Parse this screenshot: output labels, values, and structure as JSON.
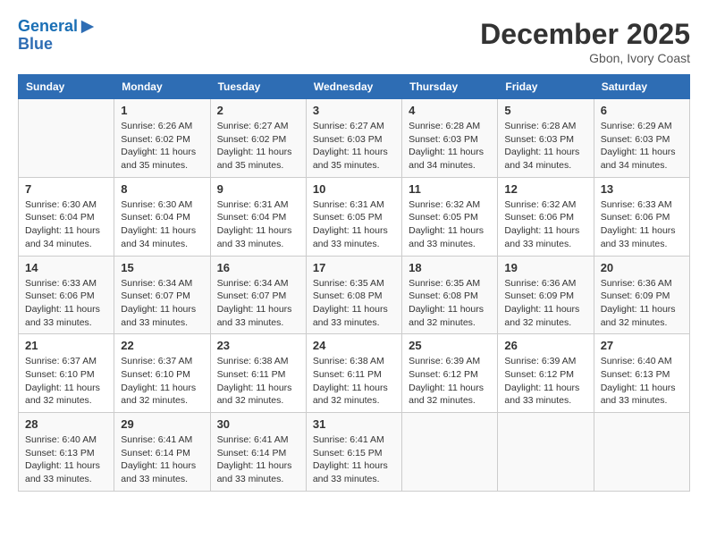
{
  "header": {
    "logo_line1": "General",
    "logo_line2": "Blue",
    "month": "December 2025",
    "location": "Gbon, Ivory Coast"
  },
  "weekdays": [
    "Sunday",
    "Monday",
    "Tuesday",
    "Wednesday",
    "Thursday",
    "Friday",
    "Saturday"
  ],
  "weeks": [
    [
      {
        "day": "",
        "detail": ""
      },
      {
        "day": "1",
        "detail": "Sunrise: 6:26 AM\nSunset: 6:02 PM\nDaylight: 11 hours\nand 35 minutes."
      },
      {
        "day": "2",
        "detail": "Sunrise: 6:27 AM\nSunset: 6:02 PM\nDaylight: 11 hours\nand 35 minutes."
      },
      {
        "day": "3",
        "detail": "Sunrise: 6:27 AM\nSunset: 6:03 PM\nDaylight: 11 hours\nand 35 minutes."
      },
      {
        "day": "4",
        "detail": "Sunrise: 6:28 AM\nSunset: 6:03 PM\nDaylight: 11 hours\nand 34 minutes."
      },
      {
        "day": "5",
        "detail": "Sunrise: 6:28 AM\nSunset: 6:03 PM\nDaylight: 11 hours\nand 34 minutes."
      },
      {
        "day": "6",
        "detail": "Sunrise: 6:29 AM\nSunset: 6:03 PM\nDaylight: 11 hours\nand 34 minutes."
      }
    ],
    [
      {
        "day": "7",
        "detail": "Sunrise: 6:30 AM\nSunset: 6:04 PM\nDaylight: 11 hours\nand 34 minutes."
      },
      {
        "day": "8",
        "detail": "Sunrise: 6:30 AM\nSunset: 6:04 PM\nDaylight: 11 hours\nand 34 minutes."
      },
      {
        "day": "9",
        "detail": "Sunrise: 6:31 AM\nSunset: 6:04 PM\nDaylight: 11 hours\nand 33 minutes."
      },
      {
        "day": "10",
        "detail": "Sunrise: 6:31 AM\nSunset: 6:05 PM\nDaylight: 11 hours\nand 33 minutes."
      },
      {
        "day": "11",
        "detail": "Sunrise: 6:32 AM\nSunset: 6:05 PM\nDaylight: 11 hours\nand 33 minutes."
      },
      {
        "day": "12",
        "detail": "Sunrise: 6:32 AM\nSunset: 6:06 PM\nDaylight: 11 hours\nand 33 minutes."
      },
      {
        "day": "13",
        "detail": "Sunrise: 6:33 AM\nSunset: 6:06 PM\nDaylight: 11 hours\nand 33 minutes."
      }
    ],
    [
      {
        "day": "14",
        "detail": "Sunrise: 6:33 AM\nSunset: 6:06 PM\nDaylight: 11 hours\nand 33 minutes."
      },
      {
        "day": "15",
        "detail": "Sunrise: 6:34 AM\nSunset: 6:07 PM\nDaylight: 11 hours\nand 33 minutes."
      },
      {
        "day": "16",
        "detail": "Sunrise: 6:34 AM\nSunset: 6:07 PM\nDaylight: 11 hours\nand 33 minutes."
      },
      {
        "day": "17",
        "detail": "Sunrise: 6:35 AM\nSunset: 6:08 PM\nDaylight: 11 hours\nand 33 minutes."
      },
      {
        "day": "18",
        "detail": "Sunrise: 6:35 AM\nSunset: 6:08 PM\nDaylight: 11 hours\nand 32 minutes."
      },
      {
        "day": "19",
        "detail": "Sunrise: 6:36 AM\nSunset: 6:09 PM\nDaylight: 11 hours\nand 32 minutes."
      },
      {
        "day": "20",
        "detail": "Sunrise: 6:36 AM\nSunset: 6:09 PM\nDaylight: 11 hours\nand 32 minutes."
      }
    ],
    [
      {
        "day": "21",
        "detail": "Sunrise: 6:37 AM\nSunset: 6:10 PM\nDaylight: 11 hours\nand 32 minutes."
      },
      {
        "day": "22",
        "detail": "Sunrise: 6:37 AM\nSunset: 6:10 PM\nDaylight: 11 hours\nand 32 minutes."
      },
      {
        "day": "23",
        "detail": "Sunrise: 6:38 AM\nSunset: 6:11 PM\nDaylight: 11 hours\nand 32 minutes."
      },
      {
        "day": "24",
        "detail": "Sunrise: 6:38 AM\nSunset: 6:11 PM\nDaylight: 11 hours\nand 32 minutes."
      },
      {
        "day": "25",
        "detail": "Sunrise: 6:39 AM\nSunset: 6:12 PM\nDaylight: 11 hours\nand 32 minutes."
      },
      {
        "day": "26",
        "detail": "Sunrise: 6:39 AM\nSunset: 6:12 PM\nDaylight: 11 hours\nand 33 minutes."
      },
      {
        "day": "27",
        "detail": "Sunrise: 6:40 AM\nSunset: 6:13 PM\nDaylight: 11 hours\nand 33 minutes."
      }
    ],
    [
      {
        "day": "28",
        "detail": "Sunrise: 6:40 AM\nSunset: 6:13 PM\nDaylight: 11 hours\nand 33 minutes."
      },
      {
        "day": "29",
        "detail": "Sunrise: 6:41 AM\nSunset: 6:14 PM\nDaylight: 11 hours\nand 33 minutes."
      },
      {
        "day": "30",
        "detail": "Sunrise: 6:41 AM\nSunset: 6:14 PM\nDaylight: 11 hours\nand 33 minutes."
      },
      {
        "day": "31",
        "detail": "Sunrise: 6:41 AM\nSunset: 6:15 PM\nDaylight: 11 hours\nand 33 minutes."
      },
      {
        "day": "",
        "detail": ""
      },
      {
        "day": "",
        "detail": ""
      },
      {
        "day": "",
        "detail": ""
      }
    ]
  ]
}
